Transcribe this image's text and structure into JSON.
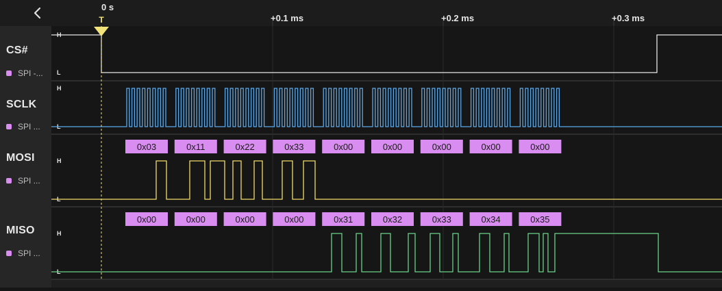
{
  "sidebar": {
    "collapse_icon": "chevron-left-icon"
  },
  "timeline": {
    "trigger_marker": "T",
    "time_labels": [
      "0 s",
      "+0.1 ms",
      "+0.2 ms",
      "+0.3 ms"
    ]
  },
  "level_labels": {
    "high": "H",
    "low": "L"
  },
  "channels": [
    {
      "name": "CS#",
      "analyzer": "SPI -...",
      "color": "#e8e8e8"
    },
    {
      "name": "SCLK",
      "analyzer": "SPI ...",
      "color": "#5aa9ec"
    },
    {
      "name": "MOSI",
      "analyzer": "SPI ...",
      "color": "#f2dc6a"
    },
    {
      "name": "MISO",
      "analyzer": "SPI ...",
      "color": "#6ad28a"
    }
  ],
  "analyzer_color": "#d98df0",
  "mosi_bytes": [
    "0x03",
    "0x11",
    "0x22",
    "0x33",
    "0x00",
    "0x00",
    "0x00",
    "0x00",
    "0x00"
  ],
  "miso_bytes": [
    "0x00",
    "0x00",
    "0x00",
    "0x00",
    "0x31",
    "0x32",
    "0x33",
    "0x34",
    "0x35"
  ]
}
